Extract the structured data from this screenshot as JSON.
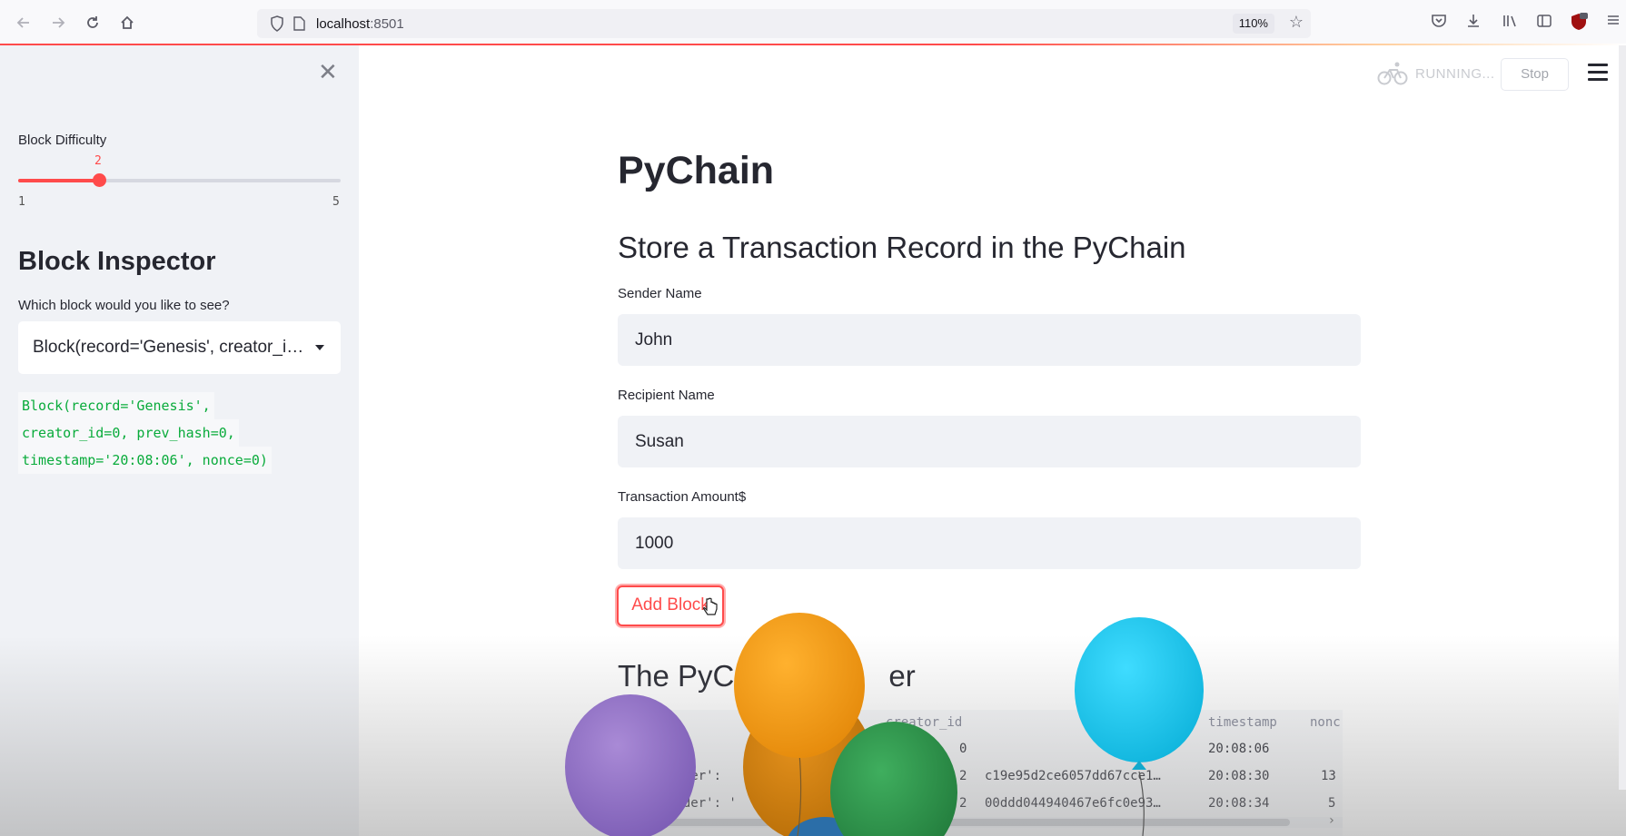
{
  "browser": {
    "url_host": "localhost",
    "url_port": ":8501",
    "zoom": "110%"
  },
  "sidebar": {
    "slider": {
      "label": "Block Difficulty",
      "value": 2,
      "value_text": "2",
      "min": 1,
      "max": 5,
      "min_text": "1",
      "max_text": "5"
    },
    "inspector_title": "Block Inspector",
    "question": "Which block would you like to see?",
    "select_value": "Block(record='Genesis', creator_id=0, prev_hash=0, timestamp='20:08:06', nonce=0)",
    "code_lines": [
      "Block(record='Genesis',",
      "creator_id=0, prev_hash=0,",
      "timestamp='20:08:06', nonce=0)"
    ]
  },
  "status": {
    "running": "RUNNING...",
    "stop": "Stop"
  },
  "main": {
    "title": "PyChain",
    "subtitle": "Store a Transaction Record in the PyChain",
    "sender_label": "Sender Name",
    "sender_value": "John",
    "recipient_label": "Recipient Name",
    "recipient_value": "Susan",
    "amount_label": "Transaction Amount$",
    "amount_value": "1000",
    "add_button": "Add Block",
    "ledger_title_left": "The PyC",
    "ledger_title_right": "er"
  },
  "ledger": {
    "headers": {
      "creator_id": "creator_id",
      "timestamp": "timestamp",
      "nonce": "nonc"
    },
    "rows": [
      {
        "record": "",
        "creator_id": "0",
        "hash": "",
        "timestamp": "20:08:06",
        "nonce": ""
      },
      {
        "record": "ender':",
        "creator_id": "2",
        "hash": "c19e95d2ce6057dd67cce1…",
        "timestamp": "20:08:30",
        "nonce": "13"
      },
      {
        "record": "ender': '",
        "creator_id": "2",
        "hash": "00ddd044940467e6fc0e93…",
        "timestamp": "20:08:34",
        "nonce": "5"
      }
    ]
  },
  "colors": {
    "accent": "#ff4b4b",
    "code_green": "#09ab3b",
    "sidebar_bg": "#f0f2f6"
  }
}
